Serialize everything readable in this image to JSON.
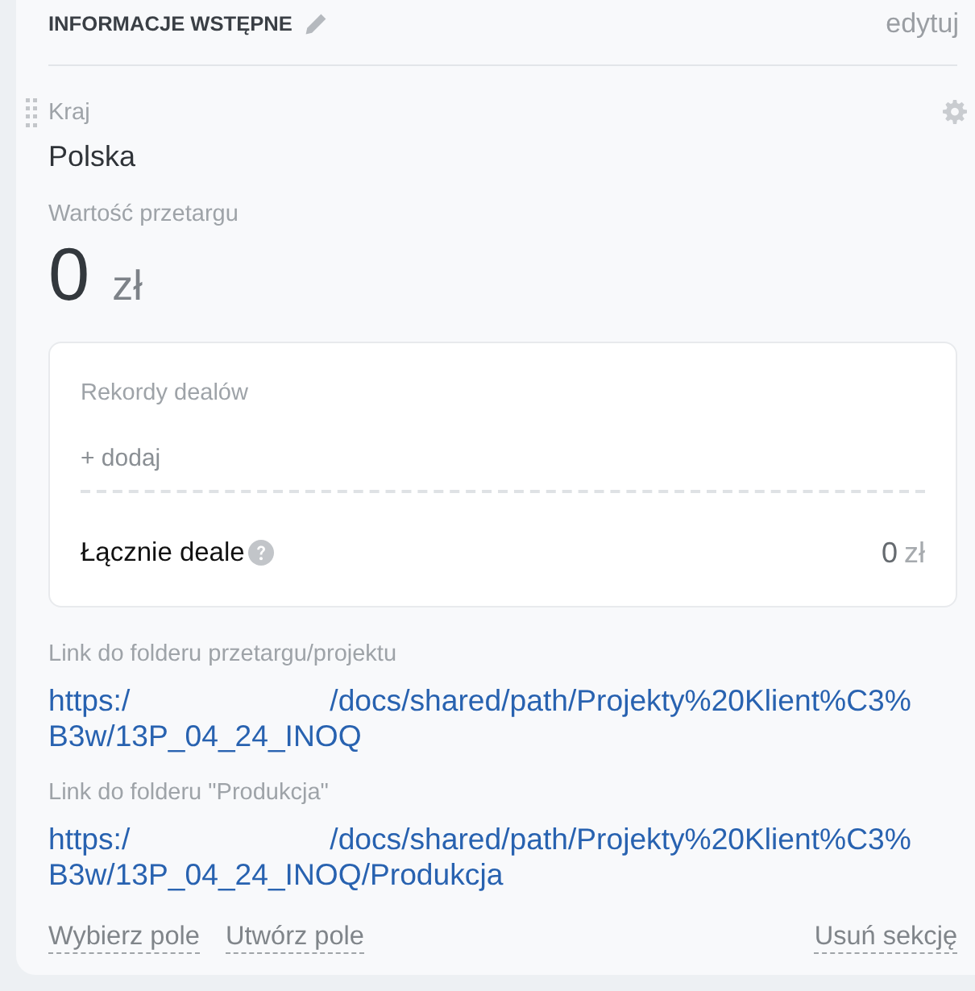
{
  "section": {
    "title": "INFORMACJE WSTĘPNE",
    "edit_link": "edytuj"
  },
  "fields": [
    {
      "kind": "text",
      "hovered": true,
      "label": "Kraj",
      "value": "Polska"
    },
    {
      "kind": "money",
      "hovered": false,
      "label": "Wartość przetargu",
      "amount": "0",
      "currency": "zł"
    },
    {
      "kind": "deals",
      "hovered": false,
      "label": "Rekordy dealów",
      "add_link": "+ dodaj",
      "total_label": "Łącznie deale",
      "total_amount": "0",
      "total_currency": "zł"
    },
    {
      "kind": "link",
      "hovered": false,
      "label": "Link do folderu przetargu/projektu",
      "url_head": "https:/",
      "url_tail": "/docs/shared/path/Projekty%20Klient%C3%B3w/13P_04_24_INOQ"
    },
    {
      "kind": "link",
      "hovered": false,
      "label": "Link do folderu \"Produkcja\"",
      "url_head": "https:/",
      "url_tail": "/docs/shared/path/Projekty%20Klient%C3%B3w/13P_04_24_INOQ/Produkcja"
    }
  ],
  "footer": {
    "actions": [
      "Wybierz pole",
      "Utwórz pole"
    ],
    "remove_link": "Usuń sekcję"
  }
}
